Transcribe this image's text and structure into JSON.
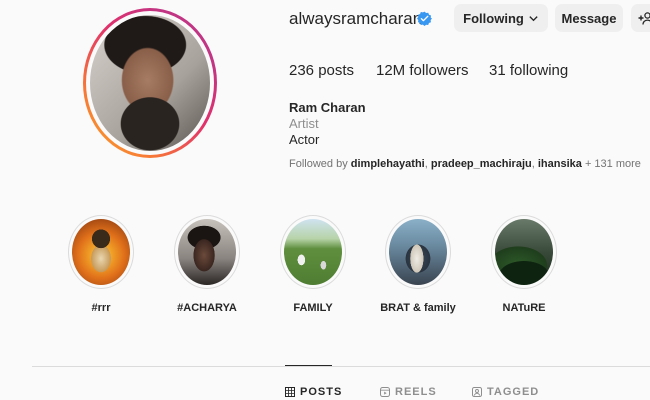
{
  "profile": {
    "username": "alwaysramcharan",
    "verified": true,
    "buttons": {
      "following": "Following",
      "message": "Message"
    },
    "stats": {
      "posts": "236 posts",
      "followers": "12M followers",
      "following": "31 following"
    },
    "bio": {
      "name": "Ram Charan",
      "category": "Artist",
      "text": "Actor"
    },
    "followed_by": {
      "prefix": "Followed by",
      "names": [
        "dimplehayathi",
        "pradeep_machiraju",
        "ihansika"
      ],
      "more": "+ 131 more"
    }
  },
  "highlights": [
    {
      "label": "#rrr"
    },
    {
      "label": "#ACHARYA"
    },
    {
      "label": "FAMILY"
    },
    {
      "label": "BRAT & family"
    },
    {
      "label": "NATuRE"
    }
  ],
  "tabs": [
    {
      "label": "POSTS",
      "active": true
    },
    {
      "label": "REELS",
      "active": false
    },
    {
      "label": "TAGGED",
      "active": false
    }
  ],
  "colors": {
    "verified_badge": "#3897f0",
    "text_primary": "#262626",
    "text_secondary": "#8e8e8e",
    "button_bg": "#efefef"
  }
}
